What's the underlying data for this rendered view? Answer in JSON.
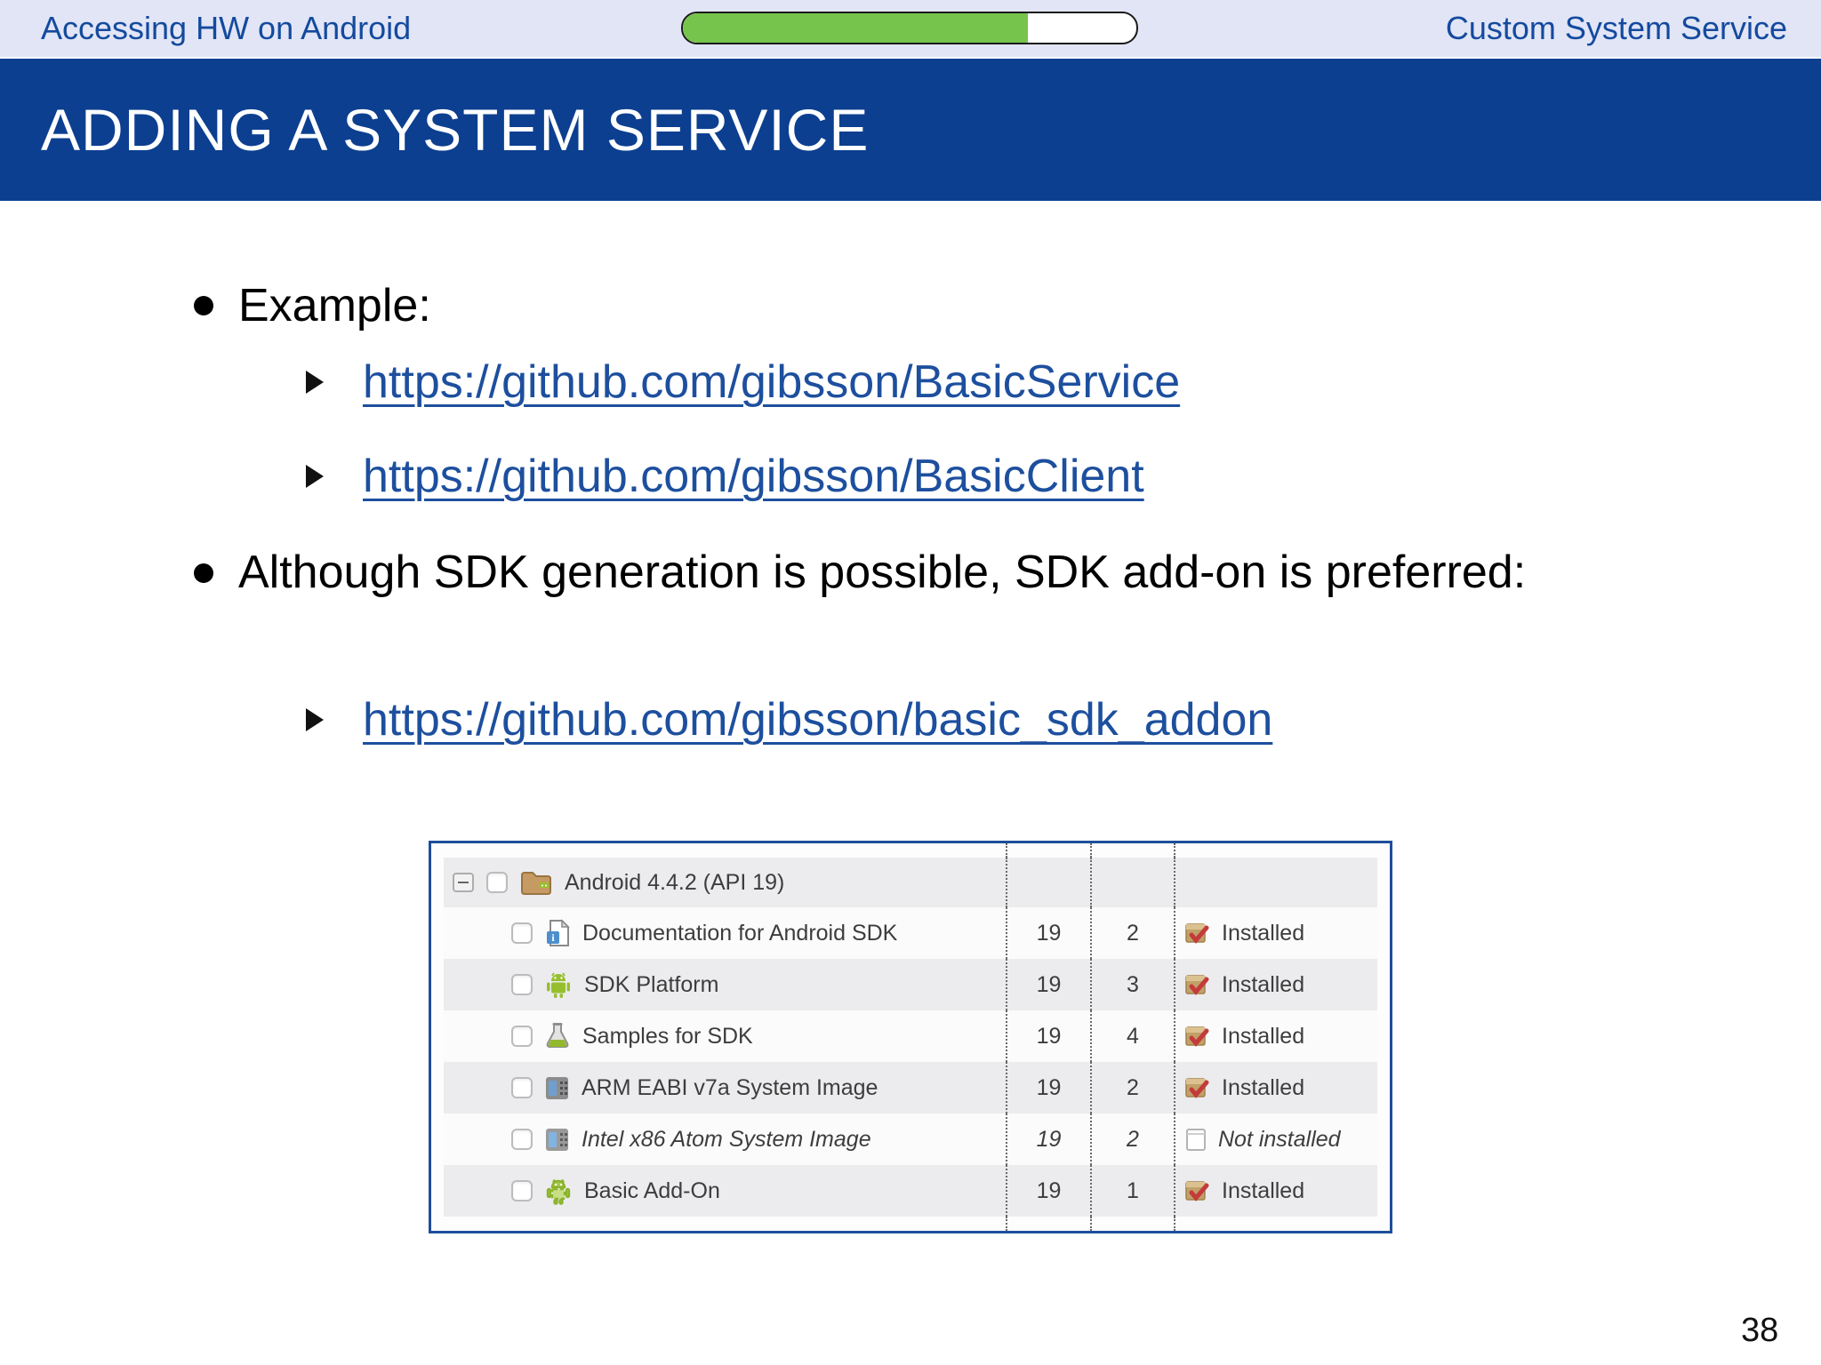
{
  "header": {
    "left_title": "Accessing HW on Android",
    "right_title": "Custom System Service",
    "progress_percent": 76,
    "progress_color": "#77c44c"
  },
  "title_bar": {
    "title": "ADDING A SYSTEM SERVICE",
    "background_color": "#0c3f90"
  },
  "content": {
    "bullet1": {
      "label": "Example:",
      "links": [
        {
          "text": "https://github.com/gibsson/BasicService"
        },
        {
          "text": "https://github.com/gibsson/BasicClient"
        }
      ]
    },
    "bullet2": {
      "label": "Although SDK generation is possible, SDK add-on is preferred:",
      "links": [
        {
          "text": "https://github.com/gibsson/basic_sdk_addon"
        }
      ]
    },
    "link_color": "#1d4f9e"
  },
  "sdk_table": {
    "border_color": "#1e4d9b",
    "group_row": {
      "name": "Android 4.4.2 (API 19)",
      "icon": "android-folder-icon",
      "collapse_icon": "collapse-minus-icon"
    },
    "rows": [
      {
        "name": "Documentation for Android SDK",
        "icon": "documentation-icon",
        "api": "19",
        "rev": "2",
        "status": "Installed",
        "status_icon": "package-installed-icon",
        "italic": false
      },
      {
        "name": "SDK Platform",
        "icon": "android-robot-icon",
        "api": "19",
        "rev": "3",
        "status": "Installed",
        "status_icon": "package-installed-icon",
        "italic": false
      },
      {
        "name": "Samples for SDK",
        "icon": "samples-flask-icon",
        "api": "19",
        "rev": "4",
        "status": "Installed",
        "status_icon": "package-installed-icon",
        "italic": false
      },
      {
        "name": "ARM EABI v7a System Image",
        "icon": "arm-chip-icon",
        "api": "19",
        "rev": "2",
        "status": "Installed",
        "status_icon": "package-installed-icon",
        "italic": false
      },
      {
        "name": "Intel x86 Atom System Image",
        "icon": "intel-chip-icon",
        "api": "19",
        "rev": "2",
        "status": "Not installed",
        "status_icon": "empty-box-icon",
        "italic": true
      },
      {
        "name": "Basic Add-On",
        "icon": "android-addon-icon",
        "api": "19",
        "rev": "1",
        "status": "Installed",
        "status_icon": "package-installed-icon",
        "italic": false
      }
    ]
  },
  "footer": {
    "page_number": "38"
  }
}
